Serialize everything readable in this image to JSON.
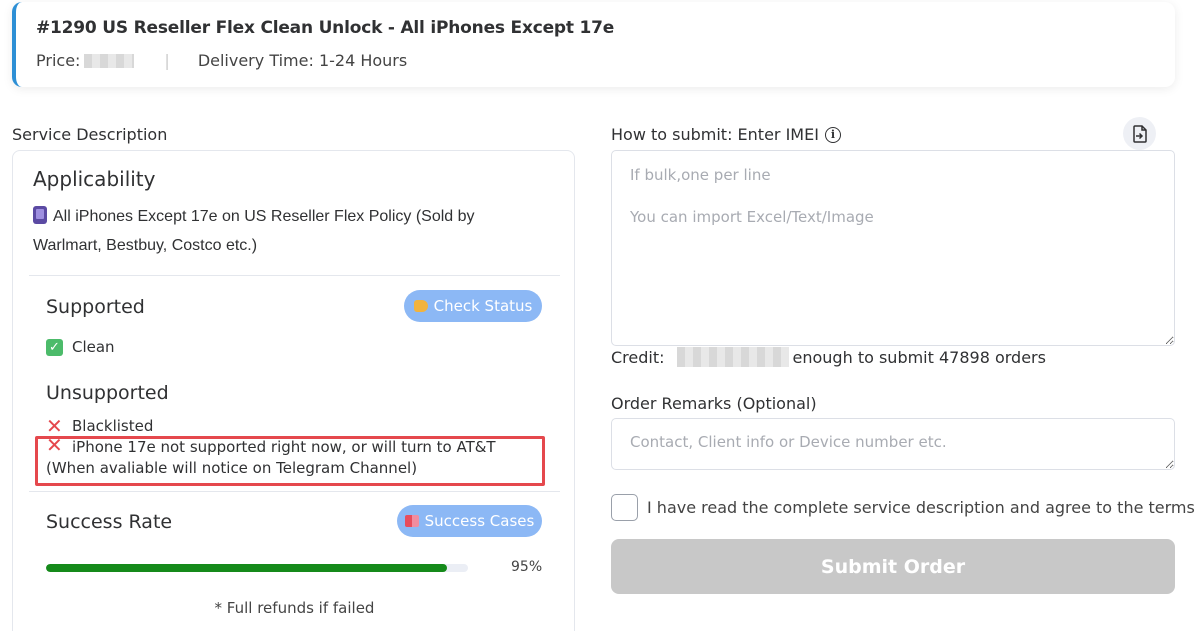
{
  "header": {
    "title": "#1290 US Reseller Flex Clean Unlock - All iPhones Except 17e",
    "price_label": "Price:",
    "separator": "|",
    "delivery": "Delivery Time: 1-24 Hours"
  },
  "left": {
    "section_label": "Service Description",
    "applicability": {
      "title": "Applicability",
      "text": "All iPhones Except 17e on US Reseller Flex Policy (Sold by Warlmart, Bestbuy, Costco etc.)"
    },
    "supported": {
      "title": "Supported",
      "check_status_label": "Check Status",
      "items": [
        "Clean"
      ]
    },
    "unsupported": {
      "title": "Unsupported",
      "items": [
        "Blacklisted",
        "iPhone 17e not supported right now, or will turn to AT&T (When avaliable will notice on Telegram Channel)"
      ]
    },
    "success": {
      "title": "Success Rate",
      "cases_label": "Success Cases",
      "rate": 95,
      "rate_text": "95%",
      "note": "* Full refunds if failed"
    }
  },
  "right": {
    "submit_label": "How to submit: Enter IMEI",
    "imei_placeholder": "If bulk,one per line\n\nYou can import Excel/Text/Image",
    "credit_label": "Credit:",
    "credit_suffix": "enough to submit 47898 orders",
    "remarks_label": "Order Remarks (Optional)",
    "remarks_placeholder": "Contact, Client info or Device number etc.",
    "agree_text": "I have read the complete service description and agree to the terms",
    "submit_button": "Submit Order"
  },
  "colors": {
    "accent_border": "#2d8fd5",
    "pill_button": "#8cb8f5",
    "progress": "#158a1a",
    "highlight": "#e5484d",
    "submit_disabled": "#c8c8c8"
  }
}
